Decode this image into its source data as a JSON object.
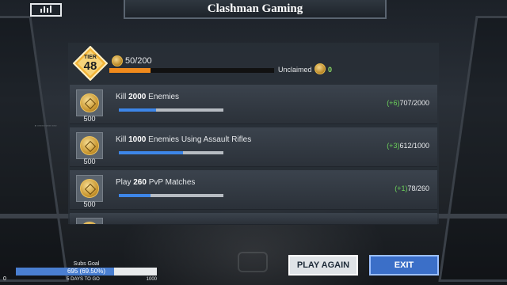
{
  "banner": {
    "title": "Clashman Gaming"
  },
  "menu": {
    "icon": "bar-chart-icon"
  },
  "tier": {
    "label": "TIER",
    "value": "48"
  },
  "progress": {
    "text": "50/200",
    "fraction": 0.25,
    "unclaimed_label": "Unclaimed",
    "unclaimed_value": "0"
  },
  "missions": [
    {
      "title_prefix": "Kill ",
      "title_bold": "2000",
      "title_suffix": " Enemies",
      "reward": "500",
      "delta": "(+6)",
      "count": "707/2000",
      "progress": 0.354
    },
    {
      "title_prefix": "Kill ",
      "title_bold": "1000",
      "title_suffix": " Enemies Using Assault Rifles",
      "reward": "500",
      "delta": "(+3)",
      "count": "612/1000",
      "progress": 0.612
    },
    {
      "title_prefix": "Play ",
      "title_bold": "260",
      "title_suffix": " PvP Matches",
      "reward": "500",
      "delta": "(+1)",
      "count": "78/260",
      "progress": 0.3
    }
  ],
  "buttons": {
    "play_again": "PLAY AGAIN",
    "exit": "EXIT"
  },
  "subs_goal": {
    "title": "Subs Goal",
    "value_text": "695 (69.50%)",
    "fraction": 0.695,
    "days_text": "5 DAYS TO GO",
    "max": "1000",
    "min": "0"
  },
  "colors": {
    "accent_orange": "#f08a1c",
    "progress_blue": "#3d86e8",
    "delta_green": "#6cd35a",
    "exit_blue": "#3b6fc8"
  }
}
